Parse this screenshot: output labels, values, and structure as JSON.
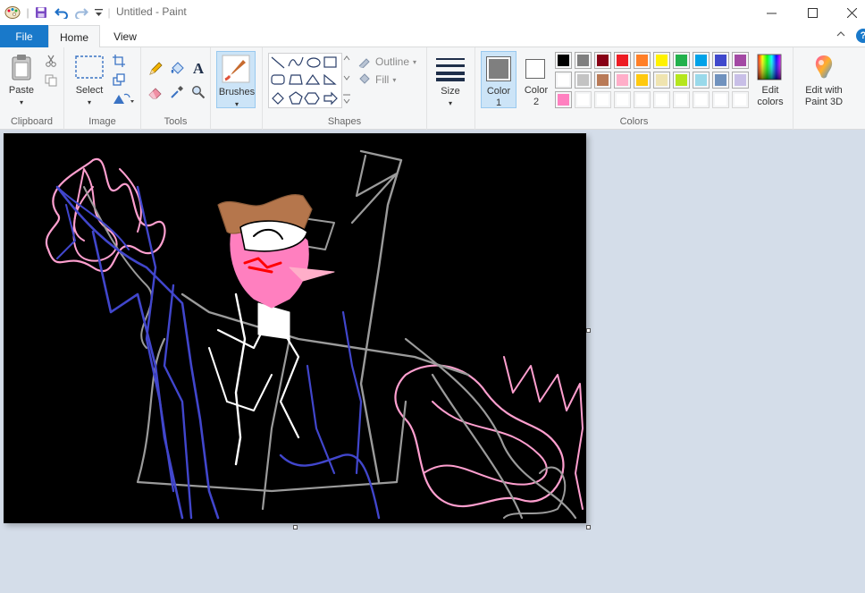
{
  "window": {
    "title": "Untitled - Paint"
  },
  "quick_access": {
    "app_icon": "paint-palette-icon",
    "save_icon": "save-icon",
    "undo_icon": "undo-icon",
    "redo_icon": "redo-icon",
    "customize_icon": "chevron-down-icon"
  },
  "window_controls": {
    "minimize": "—",
    "maximize": "☐",
    "close": "✕"
  },
  "tabs": {
    "file": "File",
    "home": "Home",
    "view": "View"
  },
  "ribbon": {
    "clipboard": {
      "paste_label": "Paste",
      "group_label": "Clipboard"
    },
    "image": {
      "select_label": "Select",
      "group_label": "Image"
    },
    "tools": {
      "group_label": "Tools",
      "text_glyph": "A"
    },
    "brushes": {
      "label": "Brushes"
    },
    "shapes": {
      "outline_label": "Outline",
      "fill_label": "Fill",
      "group_label": "Shapes"
    },
    "size": {
      "label": "Size"
    },
    "color1": {
      "label": "Color",
      "number": "1",
      "value": "#7f7f7f"
    },
    "color2": {
      "label": "Color",
      "number": "2",
      "value": "#ffffff"
    },
    "colors_group_label": "Colors",
    "edit_colors": {
      "line1": "Edit",
      "line2": "colors"
    },
    "paint3d": {
      "line1": "Edit with",
      "line2": "Paint 3D"
    }
  },
  "palette": {
    "row1": [
      "#000000",
      "#7f7f7f",
      "#880015",
      "#ed1c24",
      "#ff7f27",
      "#fff200",
      "#22b14c",
      "#00a2e8",
      "#3f48cc",
      "#a349a4"
    ],
    "row2": [
      "#ffffff",
      "#c3c3c3",
      "#b97a57",
      "#ffaec9",
      "#ffc90e",
      "#efe4b0",
      "#b5e61d",
      "#99d9ea",
      "#7092be",
      "#c8bfe7"
    ],
    "row3": [
      "#ff80c0",
      "#ffffff",
      "#ffffff",
      "#ffffff",
      "#ffffff",
      "#ffffff",
      "#ffffff",
      "#ffffff",
      "#ffffff",
      "#ffffff"
    ]
  },
  "canvas": {
    "background": "#000000"
  }
}
